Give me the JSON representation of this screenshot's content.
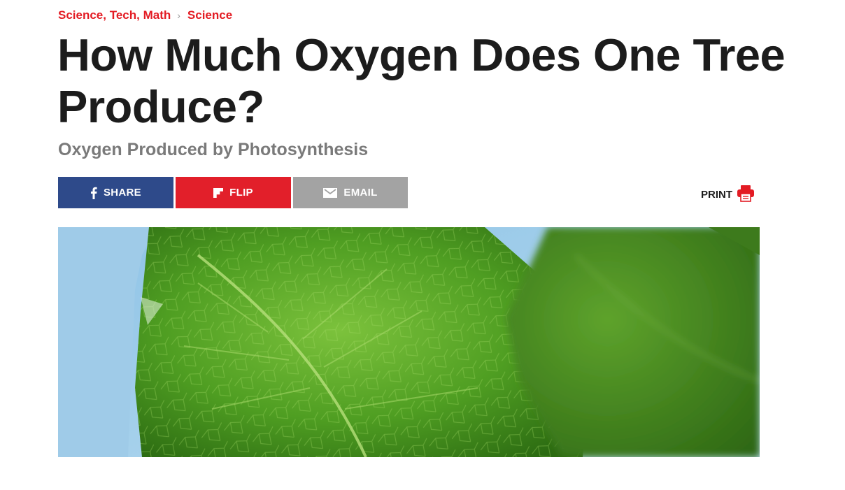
{
  "breadcrumb": {
    "items": [
      "Science, Tech, Math",
      "Science"
    ],
    "separator": "›"
  },
  "article": {
    "title": "How Much Oxygen Does One Tree Produce?",
    "subtitle": "Oxygen Produced by Photosynthesis"
  },
  "share": {
    "facebook_label": "SHARE",
    "flipboard_label": "FLIP",
    "email_label": "EMAIL",
    "facebook_icon": "facebook-icon",
    "flipboard_icon": "flipboard-icon",
    "email_icon": "envelope-icon"
  },
  "print": {
    "label": "PRINT",
    "icon": "printer-icon"
  },
  "colors": {
    "accent": "#e31b23",
    "facebook": "#2e4a8a",
    "flipboard": "#e21f2a",
    "email": "#a3a3a3",
    "subtitle": "#7a7a7a",
    "title": "#1c1c1c"
  }
}
